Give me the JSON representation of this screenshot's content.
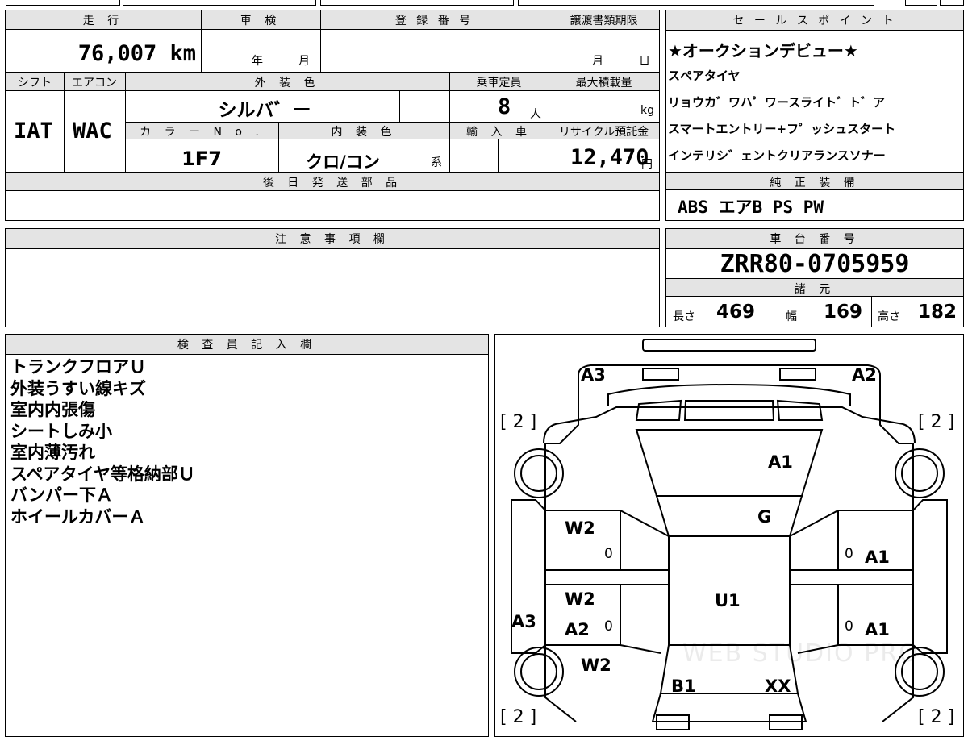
{
  "top": {
    "headers": {
      "mileage": "走 行",
      "inspection": "車 検",
      "registration": "登 録 番 号",
      "transfer_deadline": "譲渡書類期限",
      "shift": "シフト",
      "aircon": "エアコン",
      "exterior_color": "外 装 色",
      "capacity": "乗車定員",
      "max_load": "最大積載量",
      "color_no": "カ ラ ー N o .",
      "interior_color": "内 装 色",
      "import": "輸 入 車",
      "recycle": "リサイクル預託金",
      "later_parts": "後 日 発 送 部 品",
      "notes": "注 意 事 項 欄",
      "inspector": "検 査 員 記 入 欄"
    },
    "mileage": "76,007 km",
    "inspection_year_unit": "年",
    "inspection_month_unit": "月",
    "transfer_month_unit": "月",
    "transfer_day_unit": "日",
    "shift": "IAT",
    "aircon": "WAC",
    "exterior_color": "シルバ゛ー",
    "capacity": "8",
    "capacity_unit": "人",
    "max_load_unit": "kg",
    "color_no": "1F7",
    "interior_color": "クロ/コン",
    "interior_suffix": "系",
    "recycle_fee": "12,470",
    "recycle_unit": "円"
  },
  "sales_points": {
    "title": "セ ー ル ス ポ イ ン ト",
    "items": [
      "★オークションデビュー★",
      "スぺアタイヤ",
      "リョウカ゛ワハ゜ワースライト゛ト゛ア",
      "スマートエントリー+フ゜ッシュスタート",
      "インテリシ゛ェントクリアランスソナー"
    ]
  },
  "standard_equipment": {
    "title": "純 正 装 備",
    "value": "ABS エアB PS PW"
  },
  "chassis": {
    "title": "車 台 番 号",
    "value": "ZRR80-0705959"
  },
  "specs": {
    "title": "諸 元",
    "length_label": "長さ",
    "length": "469",
    "width_label": "幅",
    "width": "169",
    "height_label": "高さ",
    "height": "182"
  },
  "inspector_notes": [
    "トランクフロアＵ",
    "外装うすい線キズ",
    "室内内張傷",
    "シートしみ小",
    "室内薄汚れ",
    "スペアタイヤ等格納部Ｕ",
    "バンパー下Ａ",
    "ホイールカバーＡ"
  ],
  "diagram": {
    "tire_left_top": "[ 2 ]",
    "tire_right_top": "[ 2 ]",
    "tire_left_bottom": "[ 2 ]",
    "tire_right_bottom": "[ 2 ]",
    "labels": {
      "a3_top": "A3",
      "a2_top": "A2",
      "a1_hood": "A1",
      "g_windshield": "G",
      "w2_left_front": "W2",
      "a1_right_front": "A1",
      "w2_left_rear": "W2",
      "a2_left_rear": "A2",
      "a3_left_side": "A3",
      "u1_roof": "U1",
      "a1_right_rear": "A1",
      "w2_left_quarter": "W2",
      "b1_rear": "B1",
      "xx_rear": "XX",
      "zero_lf": "0",
      "zero_lr": "0",
      "zero_rf": "0",
      "zero_rr": "0"
    },
    "watermark": "WEB STUDIO PRO"
  }
}
